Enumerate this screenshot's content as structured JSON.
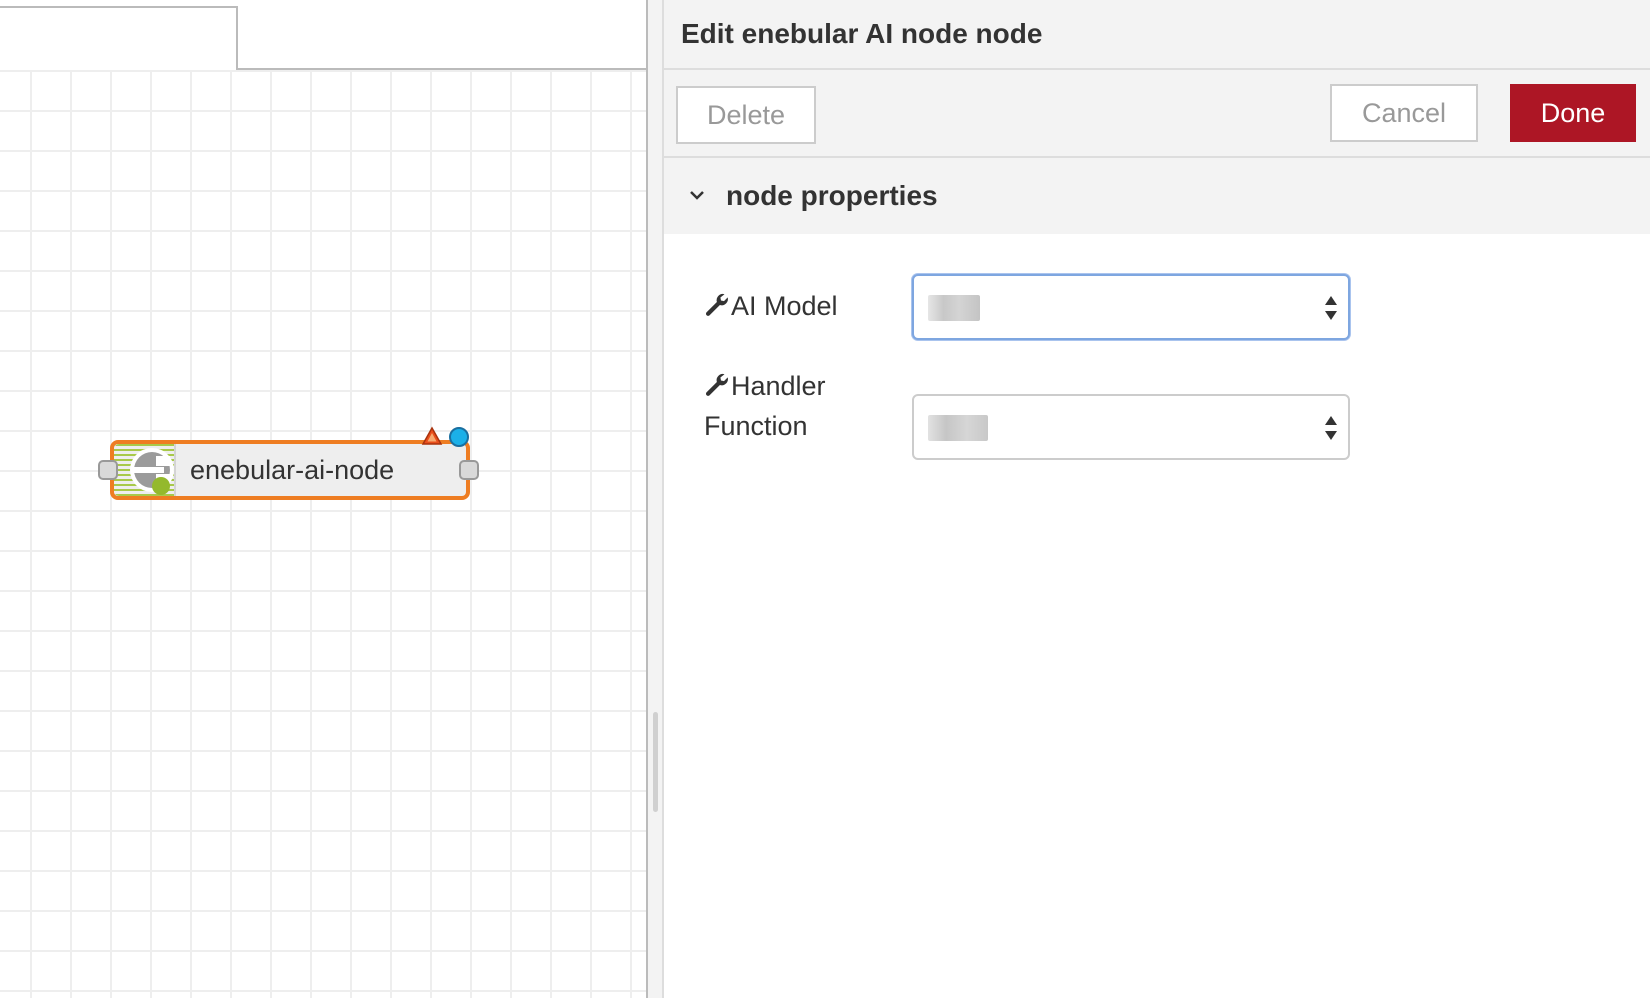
{
  "workspace": {
    "node": {
      "label": "enebular-ai-node",
      "icon": "enebular-logo-icon",
      "status": "changed"
    }
  },
  "tray": {
    "title": "Edit enebular AI node node",
    "buttons": {
      "delete_label": "Delete",
      "cancel_label": "Cancel",
      "done_label": "Done"
    },
    "section": {
      "title": "node properties",
      "expanded": true
    },
    "fields": {
      "ai_model": {
        "label": "AI Model",
        "icon": "wrench-icon",
        "value": "████"
      },
      "handler_function": {
        "label": "Handler Function",
        "icon": "wrench-icon",
        "value": "█████"
      }
    }
  },
  "colors": {
    "node_border": "#ee7d22",
    "node_stripe": "#a8c94a",
    "done_button": "#ad1625",
    "status_dot": "#1bb0e8",
    "changed_badge": "#e94e1b"
  }
}
